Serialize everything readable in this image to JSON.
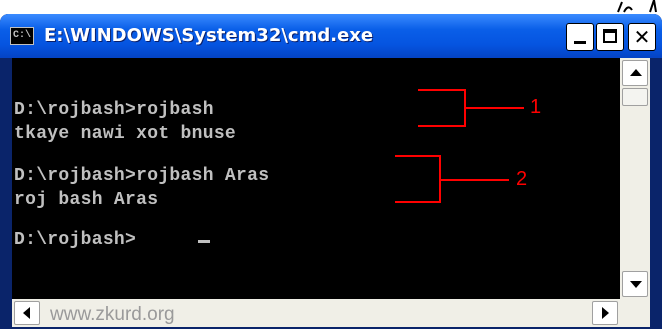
{
  "window": {
    "icon_label": "C:\\",
    "title": "E:\\WINDOWS\\System32\\cmd.exe",
    "minimize_glyph": "",
    "maximize_glyph": "",
    "close_glyph": "✕"
  },
  "console": {
    "lines": [
      "D:\\rojbash>rojbash",
      "tkaye nawi xot bnuse",
      "",
      "D:\\rojbash>rojbash Aras",
      "roj bash Aras",
      "",
      "D:\\rojbash>"
    ]
  },
  "annotations": [
    {
      "label": "1"
    },
    {
      "label": "2"
    }
  ],
  "colors": {
    "console_bg": "#000000",
    "console_text": "#c0c0c0",
    "annotation": "#ff0000",
    "titlebar": "#0554e0"
  },
  "watermark": "www.zkurd.org"
}
